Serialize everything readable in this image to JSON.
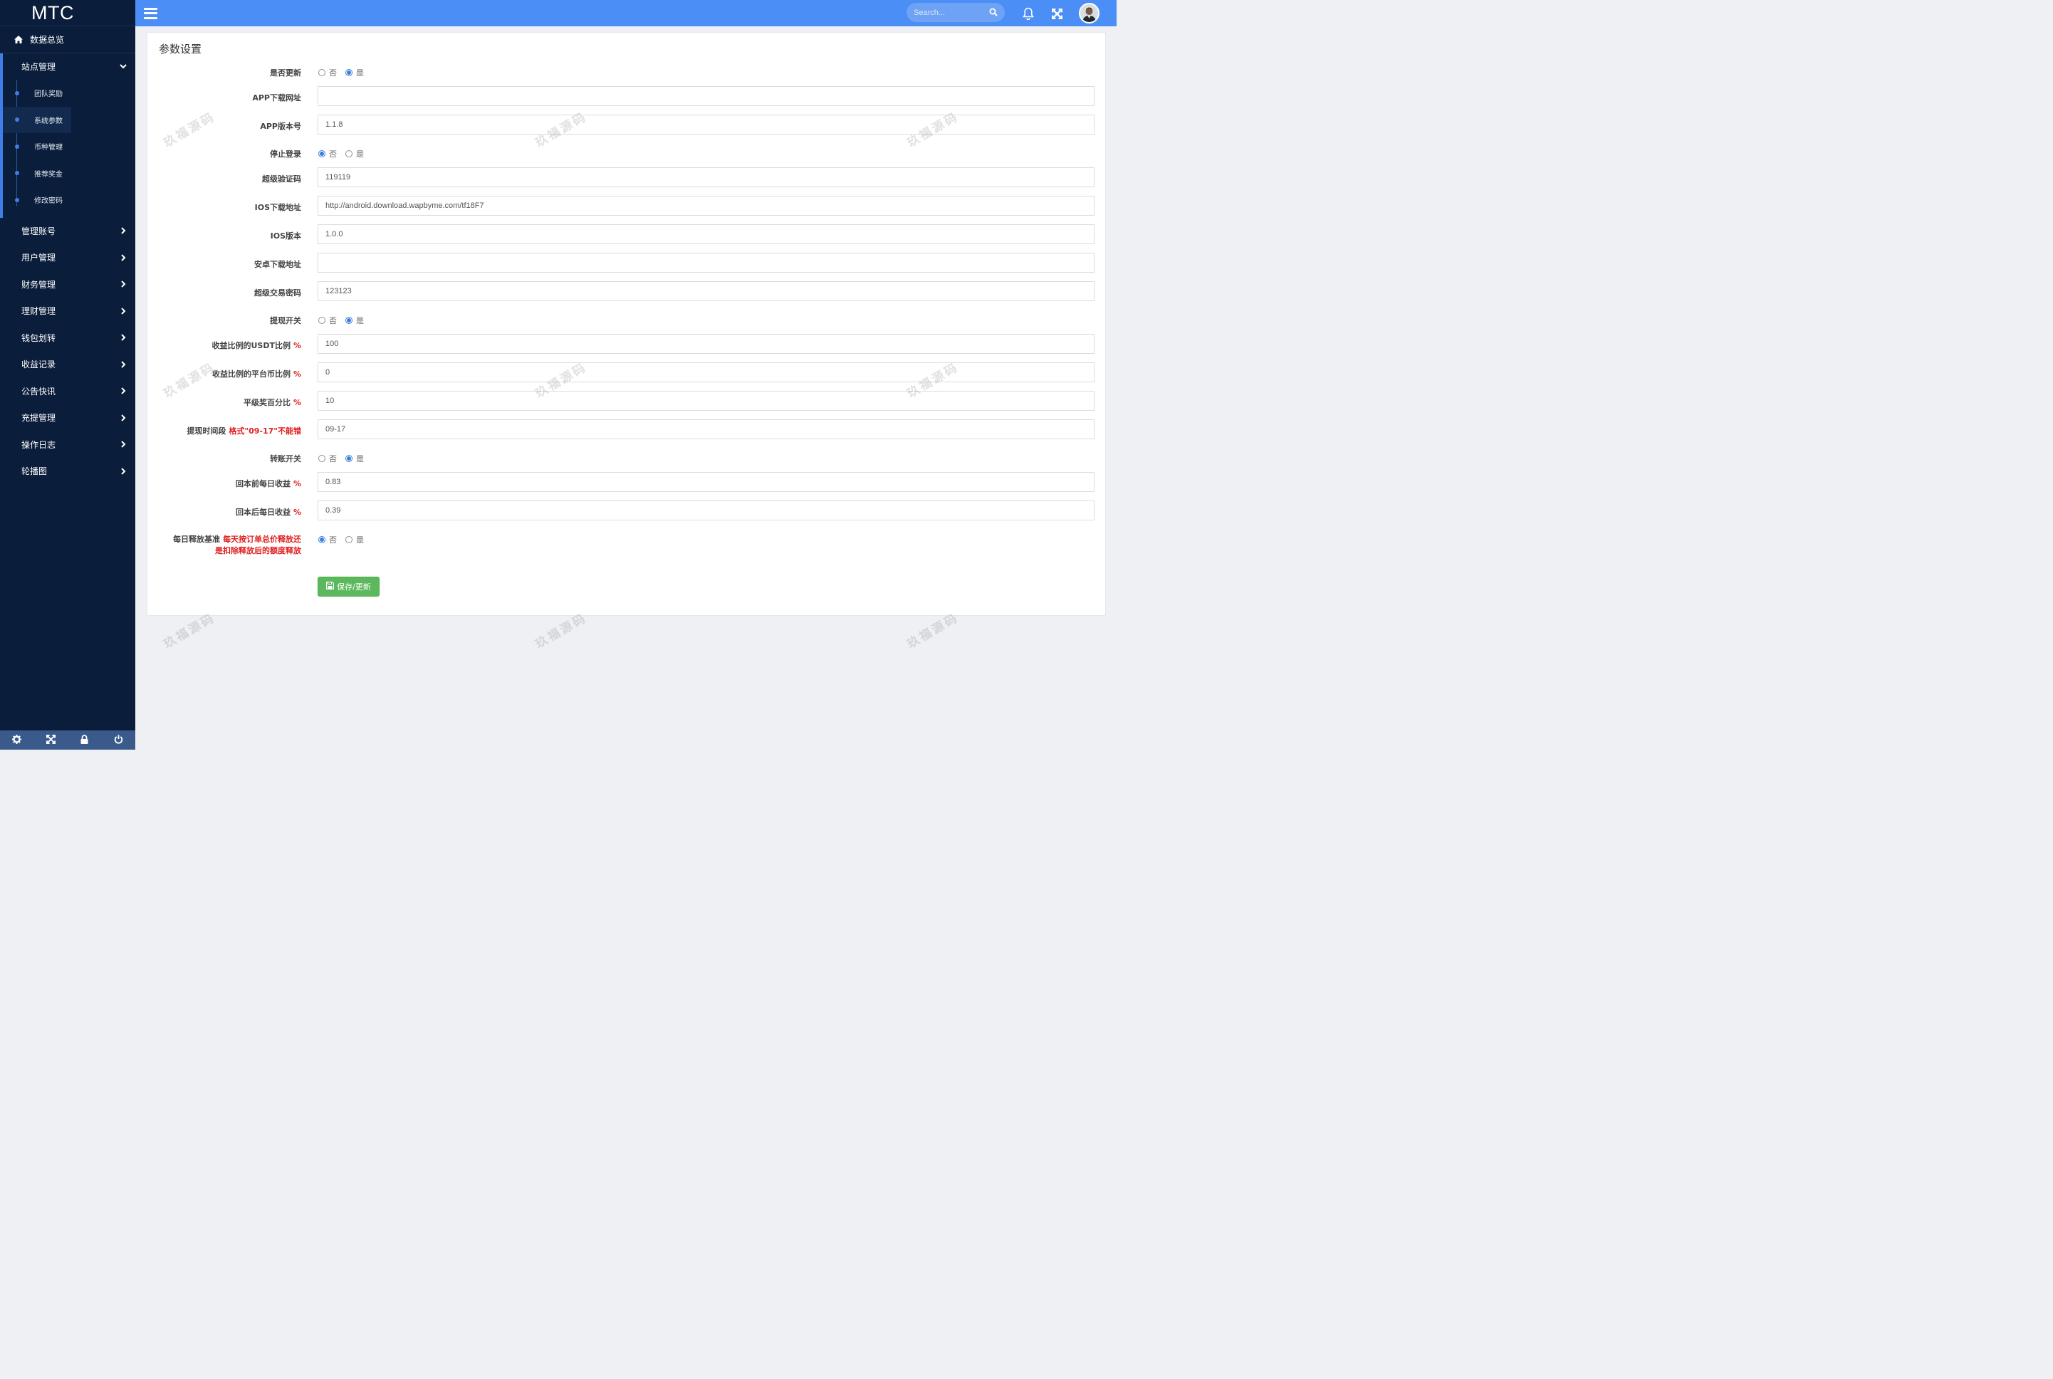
{
  "brand": "MTC",
  "sidebar": {
    "dashboard": "数据总览",
    "open_group": {
      "label": "站点管理",
      "items": [
        "团队奖励",
        "系统参数",
        "币种管理",
        "推荐奖金",
        "修改密码"
      ]
    },
    "menu": [
      "管理账号",
      "用户管理",
      "财务管理",
      "理财管理",
      "钱包划转",
      "收益记录",
      "公告快讯",
      "充提管理",
      "操作日志",
      "轮播图"
    ]
  },
  "topbar": {
    "search_placeholder": "Search..."
  },
  "panel": {
    "title": "参数设置",
    "radio_no": "否",
    "radio_yes": "是",
    "rows": {
      "update": {
        "label": "是否更新",
        "selected": "是"
      },
      "app_url": {
        "label": "APP下载网址",
        "value": ""
      },
      "app_version": {
        "label": "APP版本号",
        "value": "1.1.8"
      },
      "stop_login": {
        "label": "停止登录",
        "selected": "否"
      },
      "super_code": {
        "label": "超级验证码",
        "value": "119119"
      },
      "ios_url": {
        "label": "IOS下载地址",
        "value": "http://android.download.wapbyme.com/tf18F7"
      },
      "ios_version": {
        "label": "IOS版本",
        "value": "1.0.0"
      },
      "android_url": {
        "label": "安卓下载地址",
        "value": ""
      },
      "super_trade_pwd": {
        "label": "超级交易密码",
        "value": "123123"
      },
      "withdraw_switch": {
        "label": "提现开关",
        "selected": "是"
      },
      "usdt_ratio": {
        "label": "收益比例的USDT比例",
        "unit": "%",
        "value": "100"
      },
      "platform_ratio": {
        "label": "收益比例的平台币比例",
        "unit": "%",
        "value": "0"
      },
      "level_bonus": {
        "label": "平级奖百分比",
        "unit": "%",
        "value": "10"
      },
      "withdraw_time": {
        "label": "提现时间段",
        "note": "格式\"09-17\"不能错",
        "value": "09-17"
      },
      "transfer_switch": {
        "label": "转账开关",
        "selected": "是"
      },
      "before_daily": {
        "label": "回本前每日收益",
        "unit": "%",
        "value": "0.83"
      },
      "after_daily": {
        "label": "回本后每日收益",
        "unit": "%",
        "value": "0.39"
      },
      "daily_release": {
        "label": "每日释放基准",
        "note_line1": "每天按订单总价释放还",
        "note_line2": "是扣除释放后的额度释放",
        "selected": "否"
      }
    },
    "save_label": "保存/更新"
  },
  "watermark": "玖福源码",
  "colors": {
    "sidebar_bg": "#0a1d3b",
    "topbar_bg": "#4b8ef5",
    "accent": "#3f7ee8",
    "save_green": "#5cb85c",
    "warning_red": "#e02020"
  }
}
